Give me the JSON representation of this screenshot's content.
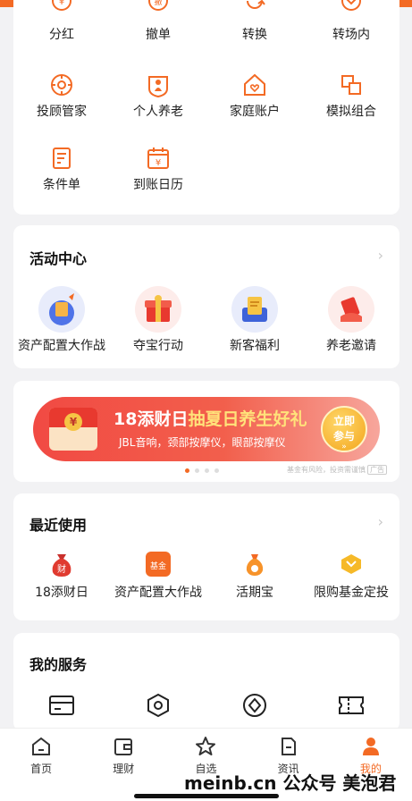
{
  "colors": {
    "accent": "#f36a24",
    "banner": "#f14a43"
  },
  "top_actions": [
    {
      "label": "分红",
      "icon": "dividend-icon"
    },
    {
      "label": "撤单",
      "icon": "cancel-order-icon"
    },
    {
      "label": "转换",
      "icon": "convert-icon"
    },
    {
      "label": "转场内",
      "icon": "transfer-icon"
    }
  ],
  "row2": [
    {
      "label": "投顾管家",
      "icon": "advisor-icon"
    },
    {
      "label": "个人养老",
      "icon": "pension-icon"
    },
    {
      "label": "家庭账户",
      "icon": "family-home-icon"
    },
    {
      "label": "模拟组合",
      "icon": "portfolio-icon"
    }
  ],
  "row3": [
    {
      "label": "条件单",
      "icon": "condition-order-icon"
    },
    {
      "label": "到账日历",
      "icon": "calendar-icon"
    }
  ],
  "activity": {
    "title": "活动中心",
    "items": [
      {
        "label": "资产配置大作战",
        "icon": "asset-battle-icon"
      },
      {
        "label": "夺宝行动",
        "icon": "treasure-icon"
      },
      {
        "label": "新客福利",
        "icon": "welfare-icon"
      },
      {
        "label": "养老邀请",
        "icon": "invite-icon"
      }
    ]
  },
  "banner": {
    "title_white": "18添财日",
    "title_yellow": "抽夏日养生好礼",
    "subtitle": "JBL音响，颈部按摩仪，眼部按摩仪",
    "cta_line1": "立即",
    "cta_line2": "参与",
    "cta_arrows": "»",
    "envelope_symbol": "¥",
    "risk_text": "基金有风险，投资需谨慎",
    "ad_tag": "广告"
  },
  "recent": {
    "title": "最近使用",
    "items": [
      {
        "label": "18添财日",
        "icon": "money-bag-icon",
        "glyph": "财"
      },
      {
        "label": "资产配置大作战",
        "icon": "asset-app-icon",
        "glyph": "基金"
      },
      {
        "label": "活期宝",
        "icon": "coin-bag-icon"
      },
      {
        "label": "限购基金定投",
        "icon": "gem-icon"
      }
    ]
  },
  "services": {
    "title": "我的服务"
  },
  "tabs": [
    {
      "label": "首页",
      "icon": "home-icon"
    },
    {
      "label": "理财",
      "icon": "wallet-icon"
    },
    {
      "label": "自选",
      "icon": "star-icon"
    },
    {
      "label": "资讯",
      "icon": "news-icon"
    },
    {
      "label": "我的",
      "icon": "profile-icon",
      "active": true
    }
  ],
  "watermark": "meinb.cn 公众号 美泡君"
}
